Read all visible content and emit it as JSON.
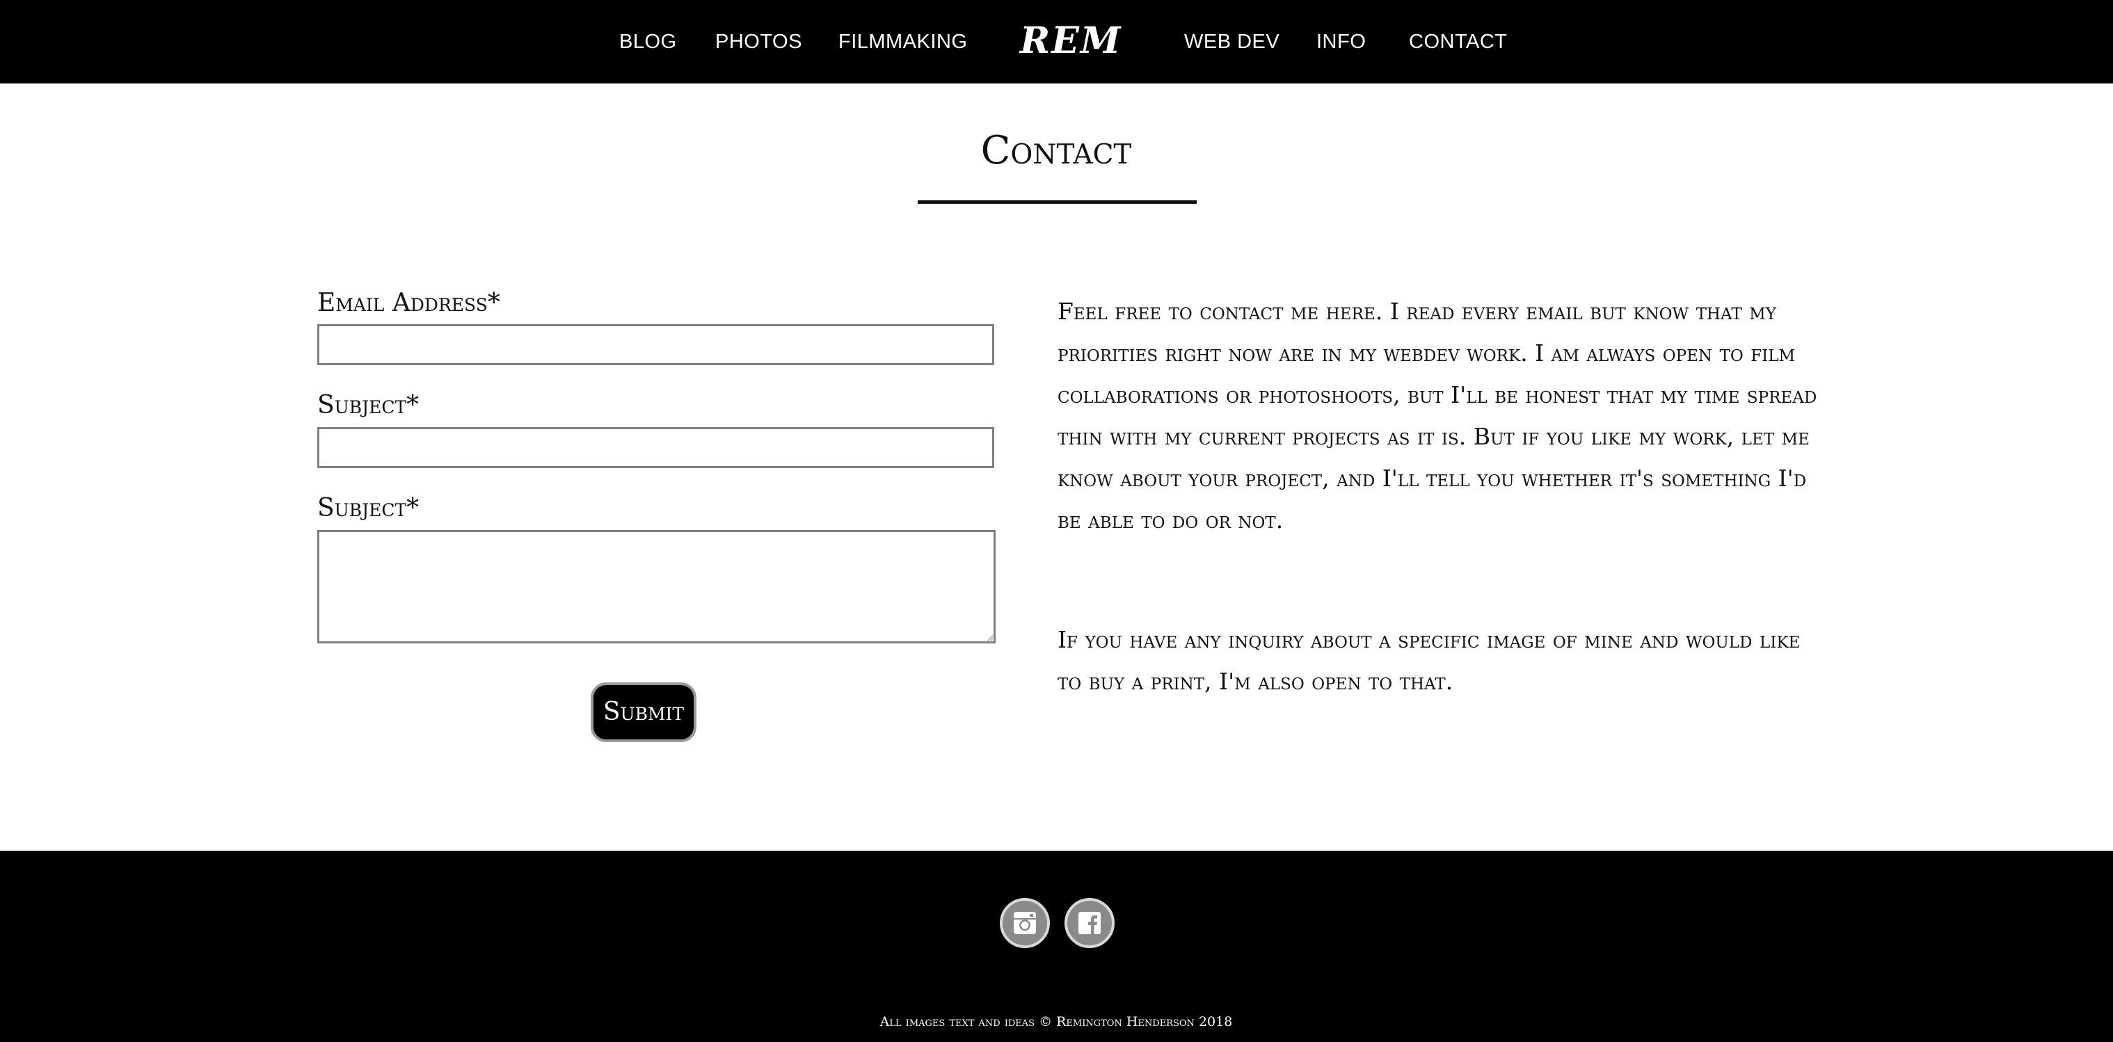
{
  "nav": {
    "items": [
      {
        "label": "BLOG"
      },
      {
        "label": "PHOTOS"
      },
      {
        "label": "FILMMAKING"
      },
      {
        "label": "WEB DEV"
      },
      {
        "label": "INFO"
      },
      {
        "label": "CONTACT"
      }
    ],
    "logo": "REM"
  },
  "page": {
    "title": "Contact"
  },
  "form": {
    "email_label": "Email Address*",
    "email_value": "",
    "subject_label": "Subject*",
    "subject_value": "",
    "message_label": "Subject*",
    "message_value": "",
    "submit_label": "Submit"
  },
  "content": {
    "paragraph_1": "Feel free to contact me here. I read every email but know that my priorities right now are in my webdev work. I am always open to film collaborations or photoshoots, but I'll be honest that my time spread thin with my current projects as it is. But if you like my work, let me know about your project, and I'll tell you whether it's something I'd be able to do or not.",
    "paragraph_2": "If you have any inquiry about a specific image of mine and would like to buy a print, I'm also open to that."
  },
  "footer": {
    "social": [
      {
        "icon": "instagram-icon"
      },
      {
        "icon": "facebook-icon"
      }
    ],
    "copyright": "All images text and ideas © Remington Henderson 2018"
  },
  "colors": {
    "nav_background": "#000000",
    "footer_background": "#000000",
    "text": "#111111",
    "button_background": "#000000",
    "icon_background": "#8a8a8a"
  }
}
